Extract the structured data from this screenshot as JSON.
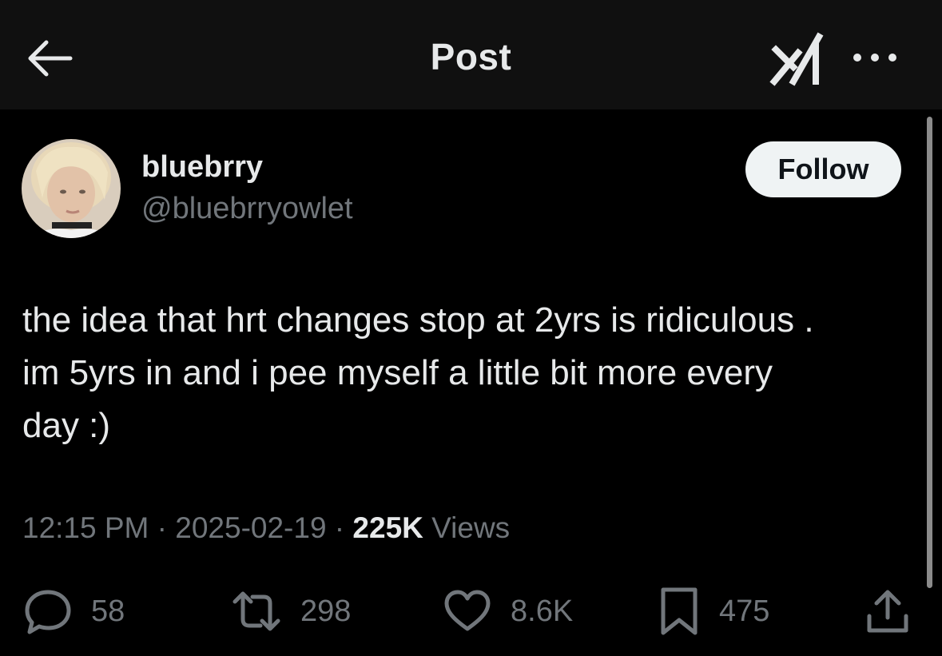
{
  "header": {
    "title": "Post",
    "back_icon": "arrow-left-icon",
    "grok_icon": "grok-logo-icon",
    "more_icon": "more-dots-icon"
  },
  "author": {
    "display_name": "bluebrry",
    "handle": "@bluebrryowlet",
    "follow_label": "Follow"
  },
  "post": {
    "text": "the idea that hrt changes stop at 2yrs is ridiculous .\nim 5yrs in and i pee myself a little bit more every\nday :)",
    "time": "12:15 PM",
    "separator": " · ",
    "date": "2025-02-19",
    "views_count": "225K",
    "views_label": " Views"
  },
  "actions": {
    "replies": "58",
    "reposts": "298",
    "likes": "8.6K",
    "bookmarks": "475"
  },
  "colors": {
    "background": "#000000",
    "header_bg": "#101010",
    "text_primary": "#e7e9ea",
    "text_secondary": "#71767b",
    "follow_bg": "#eff3f4"
  }
}
